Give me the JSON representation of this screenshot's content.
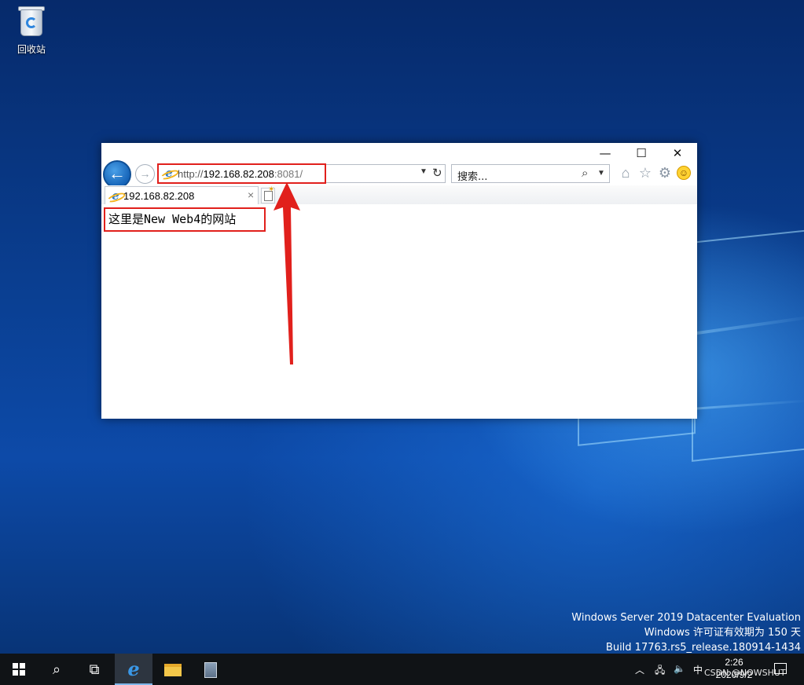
{
  "desktop": {
    "recycle_bin_label": "回收站"
  },
  "browser": {
    "caption": {
      "minimize": "—",
      "maximize": "☐",
      "close": "✕"
    },
    "back_glyph": "🡐",
    "forward_glyph": "→",
    "address": {
      "scheme": "http://",
      "host": "192.168.82.208",
      "port_path": ":8081/"
    },
    "search": {
      "placeholder": "搜索...",
      "icon": "search-icon"
    },
    "tab": {
      "title": "192.168.82.208",
      "close": "×"
    },
    "toolbar_icons": [
      "home-icon",
      "favorites-star-icon",
      "settings-gear-icon",
      "feedback-smiley-icon"
    ],
    "page": {
      "text": "这里是New Web4的网站"
    }
  },
  "annotations": {
    "highlight_color": "#e1201c"
  },
  "watermark": {
    "line1": "Windows Server 2019 Datacenter Evaluation",
    "line2": "Windows 许可证有效期为 150 天",
    "line3": "Build 17763.rs5_release.180914-1434"
  },
  "taskbar": {
    "ime": "中",
    "time": "2:26",
    "date": "2020/9/2",
    "overlay_text": "CSDN @NOWSHUT"
  }
}
